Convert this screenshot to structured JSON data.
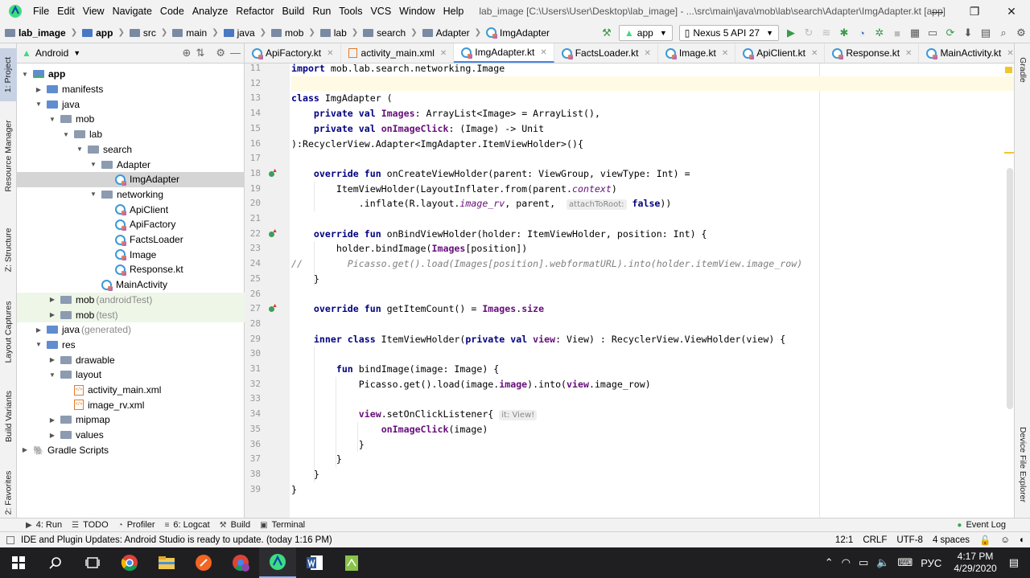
{
  "menu": {
    "items": [
      "File",
      "Edit",
      "View",
      "Navigate",
      "Code",
      "Analyze",
      "Refactor",
      "Build",
      "Run",
      "Tools",
      "VCS",
      "Window",
      "Help"
    ],
    "window_title": "lab_image [C:\\Users\\User\\Desktop\\lab_image] - ...\\src\\main\\java\\mob\\lab\\search\\Adapter\\ImgAdapter.kt [app]"
  },
  "breadcrumb": [
    "lab_image",
    "app",
    "src",
    "main",
    "java",
    "mob",
    "lab",
    "search",
    "Adapter",
    "ImgAdapter"
  ],
  "toolbar": {
    "run_config": "app",
    "device": "Nexus 5 API 27"
  },
  "left_tools": [
    "1: Project",
    "Resource Manager",
    "Z: Structure",
    "Layout Captures",
    "Build Variants",
    "2: Favorites"
  ],
  "right_tools": [
    "Gradle",
    "Device File Explorer"
  ],
  "project_panel": {
    "view_mode": "Android",
    "tree": [
      {
        "label": "app",
        "suffix": "",
        "depth": 0,
        "icon": "folder-app",
        "expanded": true,
        "bold": true
      },
      {
        "label": "manifests",
        "suffix": "",
        "depth": 1,
        "icon": "folder-blue",
        "expanded": false
      },
      {
        "label": "java",
        "suffix": "",
        "depth": 1,
        "icon": "folder-blue",
        "expanded": true
      },
      {
        "label": "mob",
        "suffix": "",
        "depth": 2,
        "icon": "folder",
        "expanded": true
      },
      {
        "label": "lab",
        "suffix": "",
        "depth": 3,
        "icon": "folder",
        "expanded": true
      },
      {
        "label": "search",
        "suffix": "",
        "depth": 4,
        "icon": "folder",
        "expanded": true
      },
      {
        "label": "Adapter",
        "suffix": "",
        "depth": 5,
        "icon": "folder",
        "expanded": true
      },
      {
        "label": "ImgAdapter",
        "suffix": "",
        "depth": 6,
        "icon": "kotlin-class",
        "selected": true
      },
      {
        "label": "networking",
        "suffix": "",
        "depth": 5,
        "icon": "folder",
        "expanded": true
      },
      {
        "label": "ApiClient",
        "suffix": "",
        "depth": 6,
        "icon": "kotlin-class"
      },
      {
        "label": "ApiFactory",
        "suffix": "",
        "depth": 6,
        "icon": "kotlin-class"
      },
      {
        "label": "FactsLoader",
        "suffix": "",
        "depth": 6,
        "icon": "kotlin-class"
      },
      {
        "label": "Image",
        "suffix": "",
        "depth": 6,
        "icon": "kotlin-class"
      },
      {
        "label": "Response.kt",
        "suffix": "",
        "depth": 6,
        "icon": "kotlin-file"
      },
      {
        "label": "MainActivity",
        "suffix": "",
        "depth": 5,
        "icon": "kotlin-class"
      },
      {
        "label": "mob",
        "suffix": "(androidTest)",
        "depth": 2,
        "icon": "folder",
        "expanded": false,
        "tinted": true
      },
      {
        "label": "mob",
        "suffix": "(test)",
        "depth": 2,
        "icon": "folder",
        "expanded": false,
        "tinted": true
      },
      {
        "label": "java",
        "suffix": "(generated)",
        "depth": 1,
        "icon": "folder-blue",
        "expanded": false
      },
      {
        "label": "res",
        "suffix": "",
        "depth": 1,
        "icon": "folder-blue",
        "expanded": true
      },
      {
        "label": "drawable",
        "suffix": "",
        "depth": 2,
        "icon": "folder",
        "expanded": false
      },
      {
        "label": "layout",
        "suffix": "",
        "depth": 2,
        "icon": "folder",
        "expanded": true
      },
      {
        "label": "activity_main.xml",
        "suffix": "",
        "depth": 3,
        "icon": "xml-file"
      },
      {
        "label": "image_rv.xml",
        "suffix": "",
        "depth": 3,
        "icon": "xml-file"
      },
      {
        "label": "mipmap",
        "suffix": "",
        "depth": 2,
        "icon": "folder",
        "expanded": false
      },
      {
        "label": "values",
        "suffix": "",
        "depth": 2,
        "icon": "folder",
        "expanded": false
      },
      {
        "label": "Gradle Scripts",
        "suffix": "",
        "depth": 0,
        "icon": "gradle",
        "expanded": false
      }
    ]
  },
  "editor_tabs": [
    {
      "label": "ApiFactory.kt",
      "icon": "kotlin",
      "active": false
    },
    {
      "label": "activity_main.xml",
      "icon": "xml",
      "active": false
    },
    {
      "label": "ImgAdapter.kt",
      "icon": "kotlin",
      "active": true
    },
    {
      "label": "FactsLoader.kt",
      "icon": "kotlin",
      "active": false
    },
    {
      "label": "Image.kt",
      "icon": "kotlin",
      "active": false
    },
    {
      "label": "ApiClient.kt",
      "icon": "kotlin",
      "active": false
    },
    {
      "label": "Response.kt",
      "icon": "kotlin",
      "active": false
    },
    {
      "label": "MainActivity.kt",
      "icon": "kotlin",
      "active": false
    }
  ],
  "code_lines": [
    {
      "n": "11",
      "html": "<span class=\"kw\">import</span> mob.lab.search.networking.Image"
    },
    {
      "n": "12",
      "html": "",
      "highlight": true
    },
    {
      "n": "13",
      "html": "<span class=\"kw\">class</span> ImgAdapter ("
    },
    {
      "n": "14",
      "html": "    <span class=\"kw\">private val</span> <span class=\"prop\">Images</span>: ArrayList&lt;Image&gt; = ArrayList(),"
    },
    {
      "n": "15",
      "html": "    <span class=\"kw\">private val</span> <span class=\"prop\">onImageClick</span>: (Image) -&gt; Unit"
    },
    {
      "n": "16",
      "html": "):RecyclerView.Adapter&lt;ImgAdapter.ItemViewHolder&gt;(){"
    },
    {
      "n": "17",
      "html": ""
    },
    {
      "n": "18",
      "html": "    <span class=\"kw\">override fun</span> onCreateViewHolder(parent: ViewGroup, viewType: Int) =",
      "marker": true
    },
    {
      "n": "19",
      "html": "        ItemViewHolder(LayoutInflater.from(parent.<span class=\"italic\">context</span>)"
    },
    {
      "n": "20",
      "html": "            .inflate(R.layout.<span class=\"italic\">image_rv</span>, parent,  <span class=\"hint\">attachToRoot:</span> <span class=\"kw\">false</span>))"
    },
    {
      "n": "21",
      "html": ""
    },
    {
      "n": "22",
      "html": "    <span class=\"kw\">override fun</span> onBindViewHolder(holder: ItemViewHolder, position: Int) {",
      "marker": true
    },
    {
      "n": "23",
      "html": "        holder.bindImage(<span class=\"prop\">Images</span>[position])"
    },
    {
      "n": "24",
      "html": "<span class=\"cmt\">//        Picasso.get().load(Images[position].webformatURL).into(holder.itemView.image_row)</span>"
    },
    {
      "n": "25",
      "html": "    }"
    },
    {
      "n": "26",
      "html": ""
    },
    {
      "n": "27",
      "html": "    <span class=\"kw\">override fun</span> getItemCount() = <span class=\"prop\">Images</span>.<span class=\"prop\">size</span>",
      "marker": true
    },
    {
      "n": "28",
      "html": ""
    },
    {
      "n": "29",
      "html": "    <span class=\"kw\">inner class</span> ItemViewHolder(<span class=\"kw\">private val</span> <span class=\"prop\">view</span>: View) : RecyclerView.ViewHolder(view) {"
    },
    {
      "n": "30",
      "html": ""
    },
    {
      "n": "31",
      "html": "        <span class=\"kw\">fun</span> bindImage(image: Image) {"
    },
    {
      "n": "32",
      "html": "            Picasso.get().load(image.<span class=\"prop\">image</span>).into(<span class=\"prop\">view</span>.image_row)"
    },
    {
      "n": "33",
      "html": ""
    },
    {
      "n": "34",
      "html": "            <span class=\"prop\">view</span>.setOnClickListener{ <span class=\"hint\">it: View!</span>"
    },
    {
      "n": "35",
      "html": "                <span class=\"prop\">onImageClick</span>(image)"
    },
    {
      "n": "36",
      "html": "            }"
    },
    {
      "n": "37",
      "html": "        }"
    },
    {
      "n": "38",
      "html": "    }"
    },
    {
      "n": "39",
      "html": "}"
    }
  ],
  "bottom_tools": [
    {
      "label": "4: Run",
      "icon": "▶"
    },
    {
      "label": "TODO",
      "icon": "☰"
    },
    {
      "label": "Profiler",
      "icon": "◔"
    },
    {
      "label": "6: Logcat",
      "icon": "≡"
    },
    {
      "label": "Build",
      "icon": "⚒"
    },
    {
      "label": "Terminal",
      "icon": "▣"
    }
  ],
  "event_log": "Event Log",
  "status": {
    "message": "IDE and Plugin Updates: Android Studio is ready to update. (today 1:16 PM)",
    "position": "12:1",
    "line_sep": "CRLF",
    "encoding": "UTF-8",
    "indent": "4 spaces"
  },
  "taskbar": {
    "language": "РУС",
    "time": "4:17 PM",
    "date": "4/29/2020"
  },
  "colors": {
    "keyword": "#000080",
    "property": "#660e7a",
    "comment": "#808080",
    "selection": "#d5d5d5",
    "current_line": "#fffae3"
  }
}
